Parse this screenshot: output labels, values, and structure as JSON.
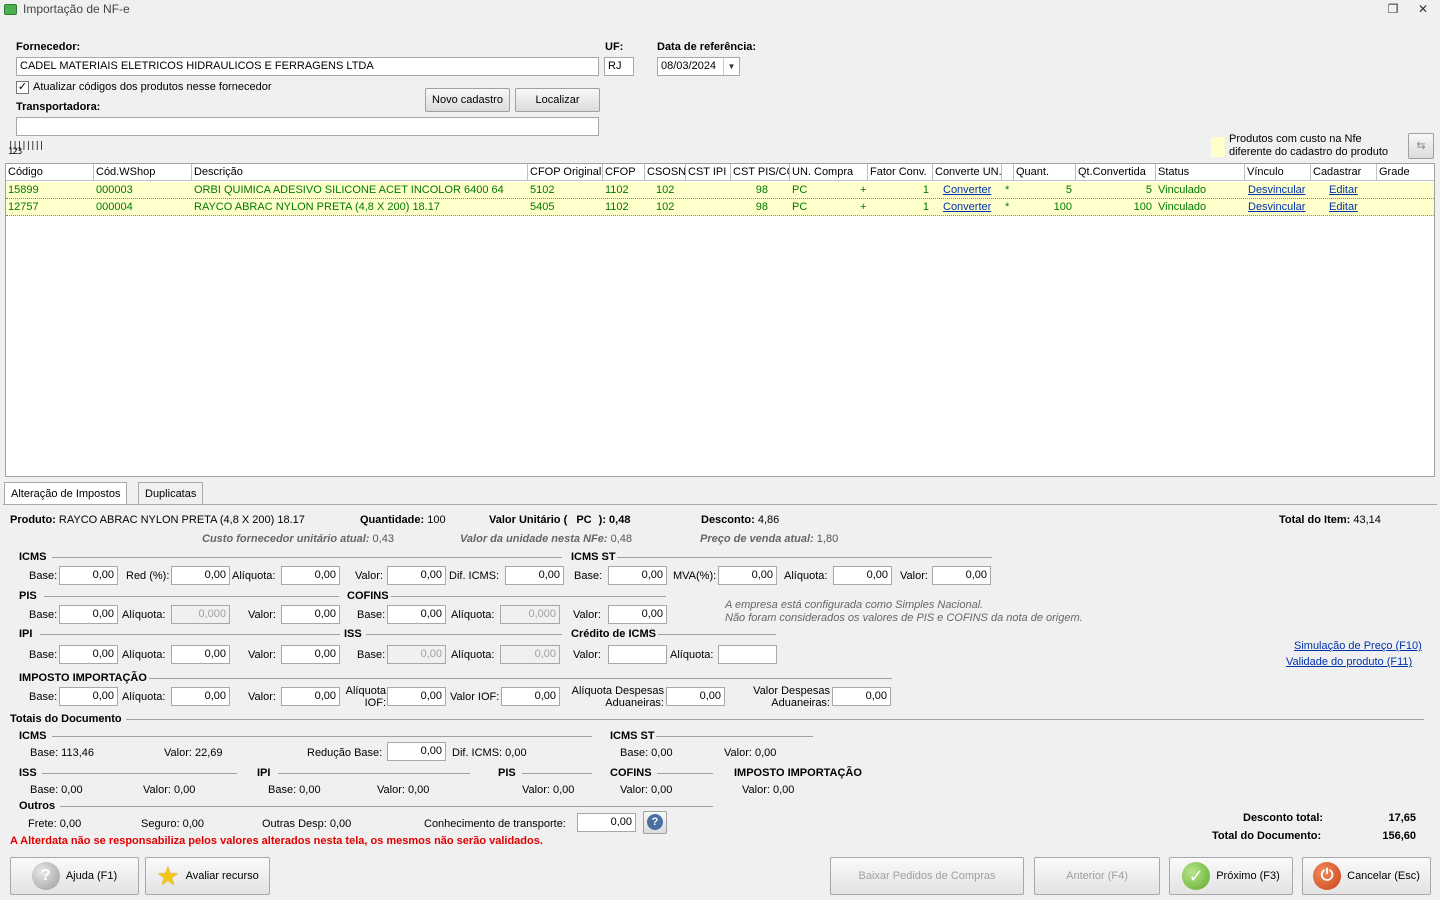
{
  "window": {
    "title": "Importação de NF-e"
  },
  "header": {
    "fornecedor_label": "Fornecedor:",
    "fornecedor_value": "CADEL MATERIAIS ELETRICOS HIDRAULICOS E FERRAGENS LTDA",
    "uf_label": "UF:",
    "uf_value": "RJ",
    "data_label": "Data de referência:",
    "data_value": "08/03/2024",
    "atualizar_label": "Atualizar códigos dos produtos nesse fornecedor",
    "transportadora_label": "Transportadora:",
    "transportadora_value": "",
    "novo_cadastro": "Novo cadastro",
    "localizar": "Localizar",
    "legend_line1": "Produtos com custo na Nfe",
    "legend_line2": "diferente do cadastro do produto"
  },
  "grid": {
    "columns": [
      "Código",
      "Cód.WShop",
      "Descrição",
      "CFOP Original",
      "CFOP",
      "CSOSN",
      "CST IPI",
      "CST PIS/COFINS",
      "UN. Compra",
      "Fator Conv.",
      "Converte UN.",
      "",
      "Quant.",
      "Qt.Convertida",
      "Status",
      "Vínculo",
      "Cadastrar",
      "Grade"
    ],
    "rows": [
      {
        "codigo": "15899",
        "wshop": "000003",
        "desc": "ORBI QUIMICA ADESIVO SILICONE ACET INCOLOR 6400 64",
        "cfop_orig": "5102",
        "cfop": "1102",
        "csosn": "102",
        "cst_ipi": "",
        "cst_pis": "98",
        "un": "PC",
        "op": "+",
        "fator": "1",
        "converter": "Converter",
        "star": "*",
        "quant": "5",
        "qtconv": "5",
        "status": "Vinculado",
        "vinculo": "Desvincular",
        "cadastrar": "Editar"
      },
      {
        "codigo": "12757",
        "wshop": "000004",
        "desc": "RAYCO ABRAC NYLON PRETA (4,8 X 200) 18.17",
        "cfop_orig": "5405",
        "cfop": "1102",
        "csosn": "102",
        "cst_ipi": "",
        "cst_pis": "98",
        "un": "PC",
        "op": "+",
        "fator": "1",
        "converter": "Converter",
        "star": "*",
        "quant": "100",
        "qtconv": "100",
        "status": "Vinculado",
        "vinculo": "Desvincular",
        "cadastrar": "Editar"
      }
    ]
  },
  "tabs": {
    "impostos": "Alteração de Impostos",
    "duplicatas": "Duplicatas"
  },
  "item": {
    "produto_label": "Produto:",
    "produto_value": "RAYCO ABRAC NYLON PRETA (4,8 X 200) 18.17",
    "quantidade_label": "Quantidade:",
    "quantidade_value": "100",
    "valor_unit_label": "Valor Unitário (",
    "valor_unit_un": "PC",
    "valor_unit_value": "): 0,48",
    "desconto_label": "Desconto:",
    "desconto_value": "4,86",
    "total_item_label": "Total do Item:",
    "total_item_value": "43,14",
    "custo_label": "Custo fornecedor unitário atual:",
    "custo_value": "0,43",
    "valor_nfe_label": "Valor da unidade nesta NFe:",
    "valor_nfe_value": "0,48",
    "preco_label": "Preço de venda atual:",
    "preco_value": "1,80"
  },
  "icms": {
    "title": "ICMS",
    "base_label": "Base:",
    "base": "0,00",
    "red_label": "Red (%):",
    "red": "0,00",
    "aliq_label": "Alíquota:",
    "aliq": "0,00",
    "valor_label": "Valor:",
    "valor": "0,00",
    "dif_label": "Dif. ICMS:",
    "dif": "0,00"
  },
  "icms_st": {
    "title": "ICMS ST",
    "base_label": "Base:",
    "base": "0,00",
    "mva_label": "MVA(%):",
    "mva": "0,00",
    "aliq_label": "Alíquota:",
    "aliq": "0,00",
    "valor_label": "Valor:",
    "valor": "0,00"
  },
  "pis": {
    "title": "PIS",
    "base_label": "Base:",
    "base": "0,00",
    "aliq_label": "Alíquota:",
    "aliq": "0,000",
    "valor_label": "Valor:",
    "valor": "0,00"
  },
  "cofins": {
    "title": "COFINS",
    "base_label": "Base:",
    "base": "0,00",
    "aliq_label": "Alíquota:",
    "aliq": "0,000",
    "valor_label": "Valor:",
    "valor": "0,00"
  },
  "simples_note": {
    "line1": "A empresa está configurada como Simples Nacional.",
    "line2": "Não foram considerados os valores de PIS e COFINS da nota de origem."
  },
  "ipi": {
    "title": "IPI",
    "base_label": "Base:",
    "base": "0,00",
    "aliq_label": "Alíquota:",
    "aliq": "0,00",
    "valor_label": "Valor:",
    "valor": "0,00"
  },
  "iss": {
    "title": "ISS",
    "base_label": "Base:",
    "base": "0,00",
    "aliq_label": "Alíquota:",
    "aliq": "0,00"
  },
  "credito": {
    "title": "Crédito de ICMS",
    "valor_label": "Valor:",
    "valor": "",
    "aliq_label": "Alíquota:",
    "aliq": ""
  },
  "links": {
    "simulacao": "Simulação de Preço (F10)",
    "validade": "Validade do produto (F11)"
  },
  "importacao": {
    "title": "IMPOSTO IMPORTAÇÃO",
    "base_label": "Base:",
    "base": "0,00",
    "aliq_label": "Alíquota:",
    "aliq": "0,00",
    "valor_label": "Valor:",
    "valor": "0,00",
    "aliq_iof_label1": "Alíquota",
    "aliq_iof_label2": "IOF:",
    "aliq_iof": "0,00",
    "valor_iof_label": "Valor IOF:",
    "valor_iof": "0,00",
    "aliq_desp_label1": "Alíquota Despesas",
    "aliq_desp_label2": "Aduaneiras:",
    "aliq_desp": "0,00",
    "valor_desp_label1": "Valor Despesas",
    "valor_desp_label2": "Aduaneiras:",
    "valor_desp": "0,00"
  },
  "totais": {
    "title": "Totais do Documento",
    "icms_title": "ICMS",
    "icms_base": "Base: 113,46",
    "icms_valor": "Valor: 22,69",
    "reducao_label": "Redução Base:",
    "reducao": "0,00",
    "dif_icms": "Dif. ICMS: 0,00",
    "icms_st_title": "ICMS ST",
    "icms_st_base": "Base: 0,00",
    "icms_st_valor": "Valor: 0,00",
    "iss_title": "ISS",
    "iss_base": "Base: 0,00",
    "iss_valor": "Valor: 0,00",
    "ipi_title": "IPI",
    "ipi_base": "Base: 0,00",
    "ipi_valor": "Valor: 0,00",
    "pis_title": "PIS",
    "pis_valor": "Valor: 0,00",
    "cofins_title": "COFINS",
    "cofins_valor": "Valor: 0,00",
    "imp_title": "IMPOSTO IMPORTAÇÃO",
    "imp_valor": "Valor: 0,00",
    "outros_title": "Outros",
    "frete": "Frete: 0,00",
    "seguro": "Seguro: 0,00",
    "outras": "Outras Desp: 0,00",
    "conhec_label": "Conhecimento de transporte:",
    "conhec": "0,00",
    "desconto_total_label": "Desconto total:",
    "desconto_total": "17,65",
    "total_doc_label": "Total do Documento:",
    "total_doc": "156,60"
  },
  "warning": "A Alterdata não se responsabiliza pelos valores alterados nesta tela, os mesmos não serão validados.",
  "footer": {
    "ajuda": "Ajuda (F1)",
    "avaliar": "Avaliar recurso",
    "baixar": "Baixar Pedidos de Compras",
    "anterior": "Anterior (F4)",
    "proximo": "Próximo (F3)",
    "cancelar": "Cancelar (Esc)"
  },
  "colors": {
    "row_bg": "#ffffcc",
    "row_text": "#007a00",
    "warning": "#e00000",
    "link": "#0033aa"
  }
}
